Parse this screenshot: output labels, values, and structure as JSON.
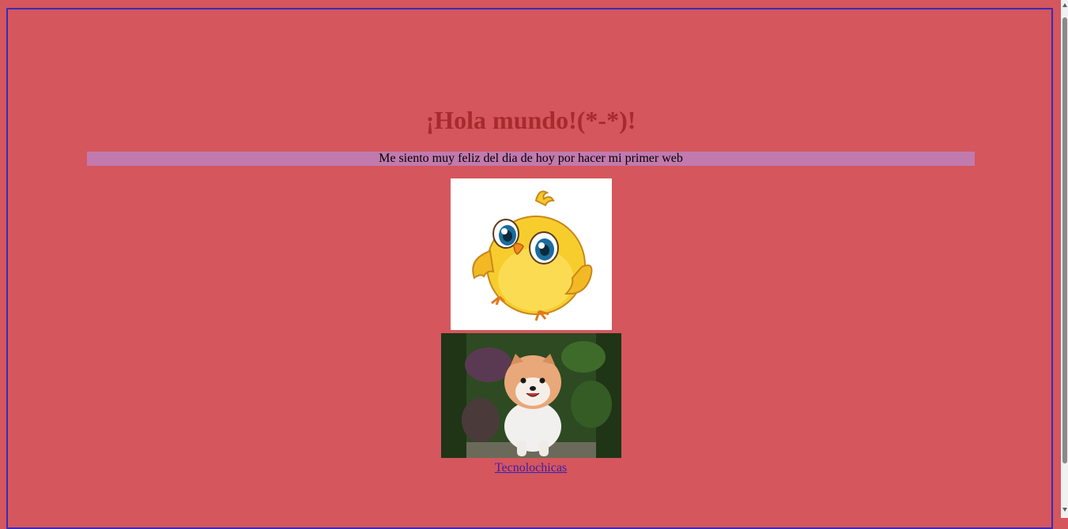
{
  "heading": "¡Hola mundo!(*-*)!",
  "banner_text": "Me siento muy feliz del dia de hoy por hacer mi primer web",
  "images": {
    "chick": "cartoon-chick",
    "dog": "pomeranian-dog-photo"
  },
  "link_text": "Tecnolochicas",
  "colors": {
    "page_bg": "#d5565d",
    "heading": "#a72a2f",
    "banner_bg": "#c27aae",
    "frame_border": "#3a2bb8",
    "link": "#3b1fa8"
  }
}
